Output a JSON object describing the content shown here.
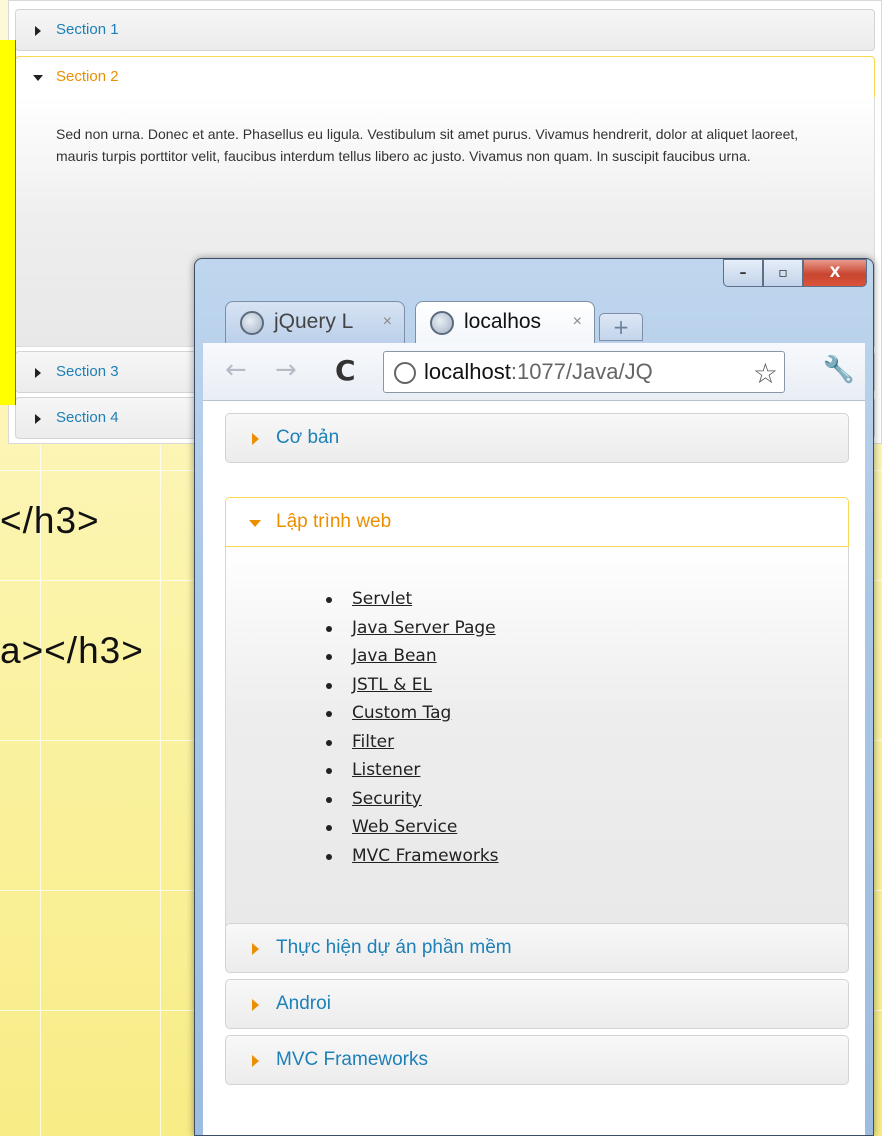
{
  "slide": {
    "code_fragment_1": "</h3>",
    "code_fragment_2": "a></h3>"
  },
  "demo_accordion": {
    "sections": [
      {
        "label": "Section 1",
        "active": false
      },
      {
        "label": "Section 2",
        "active": true
      },
      {
        "label": "Section 3",
        "active": false
      },
      {
        "label": "Section 4",
        "active": false
      }
    ],
    "active_content": "Sed non urna. Donec et ante. Phasellus eu ligula. Vestibulum sit amet purus. Vivamus hendrerit, dolor at aliquet laoreet, mauris turpis porttitor velit, faucibus interdum tellus libero ac justo. Vivamus non quam. In suscipit faucibus urna."
  },
  "browser": {
    "window_controls": {
      "minimize": "–",
      "maximize": "▫",
      "close": "X"
    },
    "tabs": [
      {
        "label": "jQuery L",
        "active": false,
        "close": "×"
      },
      {
        "label": "localhos",
        "active": true,
        "close": "×"
      }
    ],
    "new_tab": "+",
    "toolbar": {
      "back": "←",
      "forward": "→",
      "reload": "C",
      "url_host": "localhost",
      "url_path": ":1077/Java/JQ",
      "bookmark": "☆",
      "menu": "🔧"
    },
    "accordion": {
      "sections": [
        {
          "label": "Cơ bản",
          "active": false
        },
        {
          "label": "Lập trình web",
          "active": true
        },
        {
          "label": "Thực hiện dự án phần mềm",
          "active": false
        },
        {
          "label": "Androi",
          "active": false
        },
        {
          "label": "MVC Frameworks",
          "active": false
        }
      ],
      "active_links": [
        "Servlet",
        "Java Server Page",
        "Java Bean",
        "JSTL & EL",
        "Custom Tag",
        "Filter",
        "Listener",
        "Security",
        "Web Service",
        "MVC Frameworks"
      ]
    }
  }
}
